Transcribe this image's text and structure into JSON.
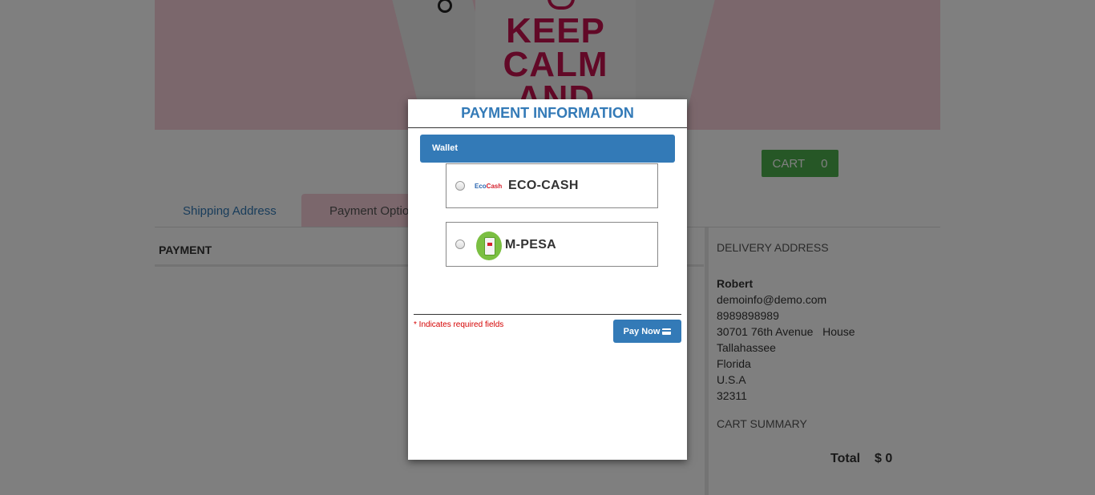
{
  "hero": {
    "line1": "KEEP",
    "line2": "CALM",
    "line3": "AND"
  },
  "cart": {
    "label": "CART",
    "count": "0"
  },
  "tabs": [
    {
      "label": "Shipping Address"
    },
    {
      "label": "Payment Option"
    }
  ],
  "payment": {
    "heading": "PAYMENT"
  },
  "delivery": {
    "heading": "DELIVERY ADDRESS",
    "name": "Robert",
    "email": "demoinfo@demo.com",
    "phone": "8989898989",
    "street": "30701 76th Avenue   House",
    "city": "Tallahassee",
    "state": "Florida",
    "country": "U.S.A",
    "zip": "32311"
  },
  "cart_summary": {
    "heading": "CART SUMMARY",
    "total_label": "Total",
    "total_value": "$ 0"
  },
  "modal": {
    "title": "PAYMENT INFORMATION",
    "wallet_label": "Wallet",
    "options": [
      {
        "logo_text_1": "Eco",
        "logo_text_2": "Cash",
        "label": "ECO-CASH"
      },
      {
        "label": "M-PESA"
      }
    ],
    "required_note": "* Indicates required fields",
    "pay_button": "Pay Now"
  },
  "colors": {
    "primary": "#337ab7",
    "success": "#4cae4c",
    "hero_bg": "#f7cfd9",
    "hero_text": "#c4134f",
    "required": "#d40000"
  }
}
